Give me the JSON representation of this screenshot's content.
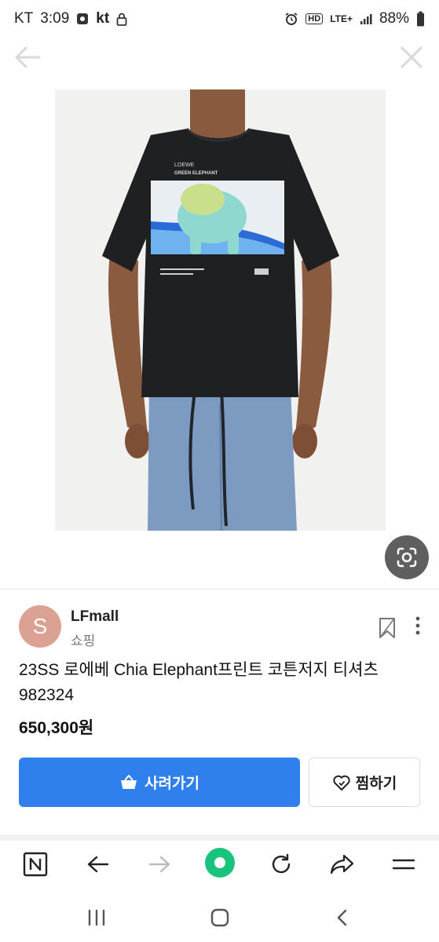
{
  "status_bar": {
    "carrier": "KT",
    "time": "3:09",
    "operator_logo": "kt",
    "network": "LTE+",
    "hd": "HD",
    "battery": "88%"
  },
  "seller": {
    "avatar_letter": "S",
    "name": "LFmall",
    "category": "쇼핑"
  },
  "product": {
    "title": "23SS 로에베 Chia Elephant프린트 코튼저지 티셔츠 982324",
    "price": "650,300원",
    "shirt_print_brand": "LOEWE",
    "shirt_print_text": "GREEN ELEPHANT"
  },
  "actions": {
    "buy_label": "사려가기",
    "wish_label": "찜하기"
  },
  "colors": {
    "buy_button": "#2f80ed",
    "avatar": "#dba293",
    "toolbar_green": "#19c37d"
  },
  "icons": [
    "back-arrow-icon",
    "close-icon",
    "lens-icon",
    "bookmark-icon",
    "more-icon",
    "cart-icon",
    "heart-icon",
    "naver-n-icon",
    "back-icon",
    "forward-icon",
    "home-dot-icon",
    "refresh-icon",
    "share-icon",
    "menu-icon",
    "recents-icon",
    "home-icon",
    "system-back-icon"
  ]
}
